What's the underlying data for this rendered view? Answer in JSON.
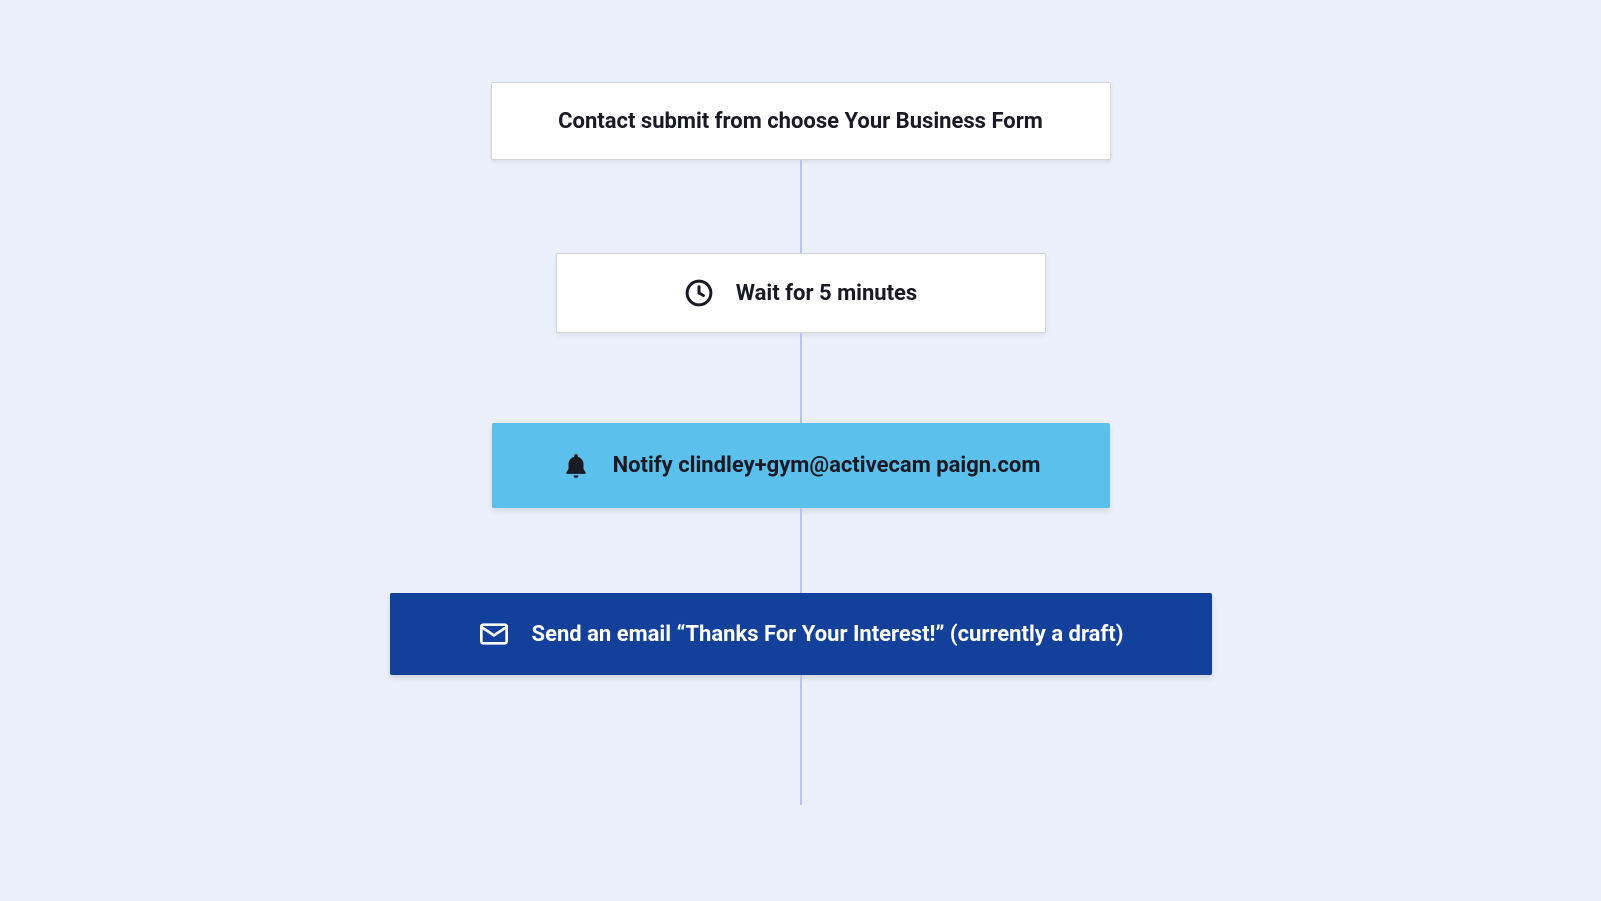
{
  "flow": {
    "trigger": {
      "label": "Contact submit from choose Your Business Form"
    },
    "wait": {
      "label": "Wait for 5 minutes"
    },
    "notify": {
      "label": "Notify clindley+gym@activecam paign.com"
    },
    "email": {
      "label": "Send an email “Thanks For Your Interest!” (currently a draft)"
    }
  },
  "colors": {
    "page_bg": "#EBF0FA",
    "card_bg": "#FFFFFF",
    "notify_bg": "#5BC0EB",
    "email_bg": "#12409A",
    "connector": "#B7C6EA",
    "text_dark": "#1A1A24",
    "text_light": "#FFFFFF"
  }
}
